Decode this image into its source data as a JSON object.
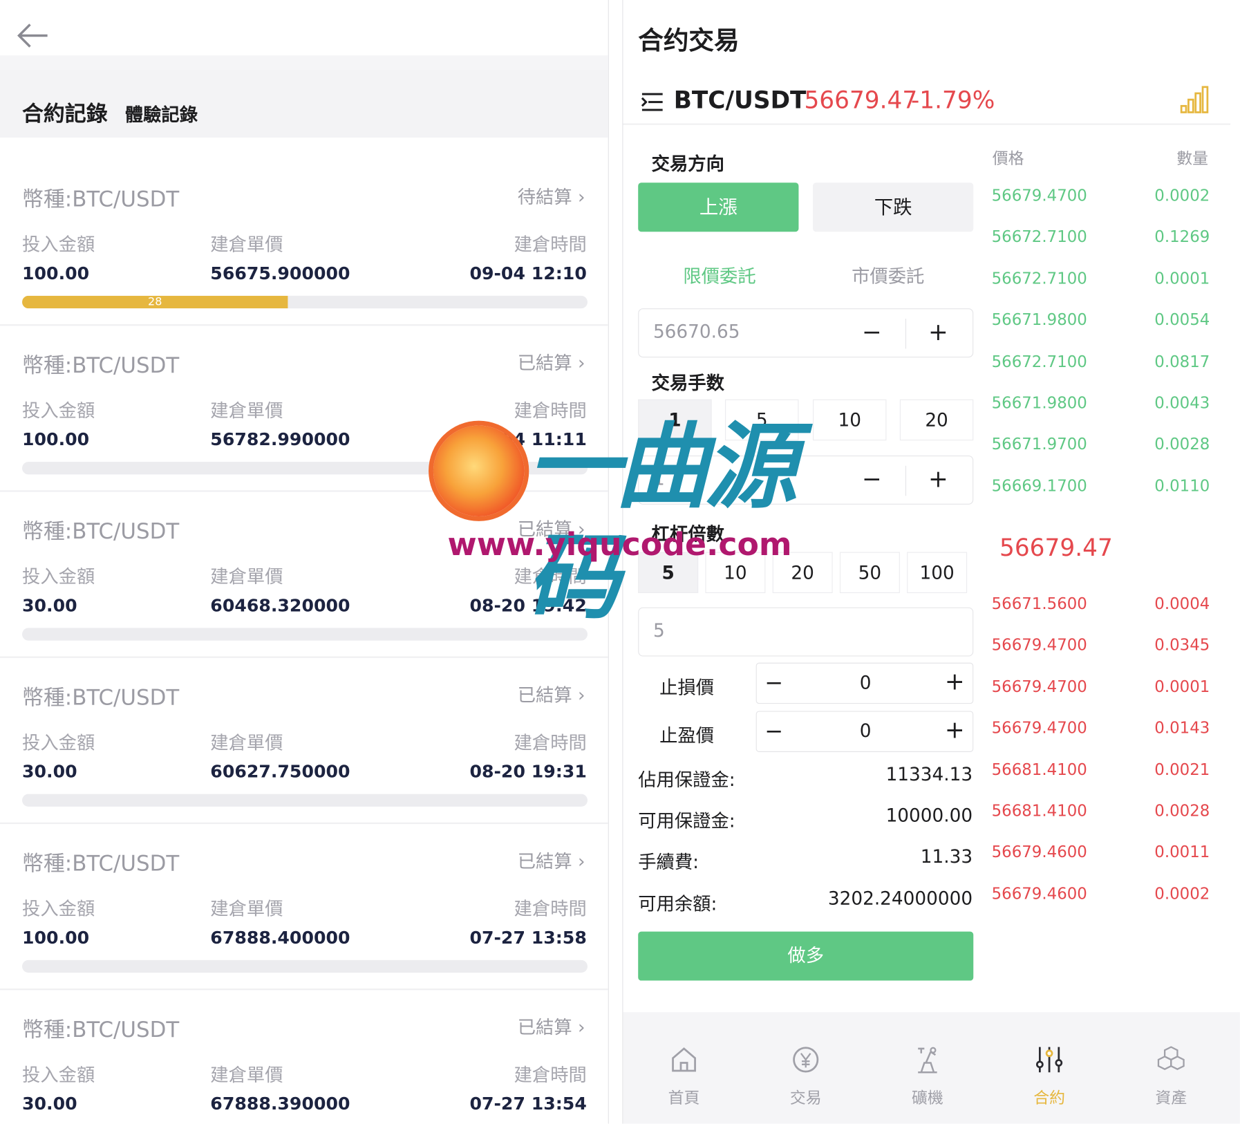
{
  "left": {
    "tabs": {
      "records": "合約記錄",
      "trial": "體驗記錄"
    },
    "records": [
      {
        "coin": "幣種:BTC/USDT",
        "status": "待結算",
        "h1": "投入金額",
        "h2": "建倉單價",
        "h3": "建倉時間",
        "amount": "100.00",
        "unit_price": "56675.900000",
        "time": "09-04 12:10",
        "progress": 0.47,
        "progress_label": "28"
      },
      {
        "coin": "幣種:BTC/USDT",
        "status": "已結算",
        "h1": "投入金額",
        "h2": "建倉單價",
        "h3": "建倉時間",
        "amount": "100.00",
        "unit_price": "56782.990000",
        "time": "09-04 11:11",
        "progress": 0,
        "progress_label": ""
      },
      {
        "coin": "幣種:BTC/USDT",
        "status": "已結算",
        "h1": "投入金額",
        "h2": "建倉單價",
        "h3": "建倉時間",
        "amount": "30.00",
        "unit_price": "60468.320000",
        "time": "08-20 19:42",
        "progress": 0,
        "progress_label": ""
      },
      {
        "coin": "幣種:BTC/USDT",
        "status": "已結算",
        "h1": "投入金額",
        "h2": "建倉單價",
        "h3": "建倉時間",
        "amount": "30.00",
        "unit_price": "60627.750000",
        "time": "08-20 19:31",
        "progress": 0,
        "progress_label": ""
      },
      {
        "coin": "幣種:BTC/USDT",
        "status": "已結算",
        "h1": "投入金額",
        "h2": "建倉單價",
        "h3": "建倉時間",
        "amount": "100.00",
        "unit_price": "67888.400000",
        "time": "07-27 13:58",
        "progress": 0,
        "progress_label": ""
      },
      {
        "coin": "幣種:BTC/USDT",
        "status": "已結算",
        "h1": "投入金額",
        "h2": "建倉單價",
        "h3": "建倉時間",
        "amount": "30.00",
        "unit_price": "67888.390000",
        "time": "07-27 13:54",
        "progress": 0,
        "progress_label": ""
      }
    ]
  },
  "right": {
    "title": "合约交易",
    "pair": "BTC/USDT",
    "price": "56679.47",
    "change": "-1.79%",
    "direction_label": "交易方向",
    "btn_up": "上漲",
    "btn_down": "下跌",
    "limit_order": "限價委託",
    "market_order": "市價委託",
    "price_input": "56670.65",
    "lots_label": "交易手数",
    "lots_options": [
      "1",
      "5",
      "10",
      "20"
    ],
    "lots_input": "1",
    "leverage_label": "杠杆倍數",
    "leverage_options": [
      "5",
      "10",
      "20",
      "50",
      "100"
    ],
    "leverage_input": "5",
    "stop_loss_label": "止損價",
    "stop_loss_value": "0",
    "take_profit_label": "止盈價",
    "take_profit_value": "0",
    "margin_used_label": "佔用保證金:",
    "margin_used": "11334.13",
    "margin_avail_label": "可用保證金:",
    "margin_avail": "10000.00",
    "fee_label": "手續費:",
    "fee": "11.33",
    "balance_label": "可用余額:",
    "balance": "3202.24000000",
    "submit": "做多",
    "book_price_header": "價格",
    "book_qty_header": "數量",
    "asks": [
      {
        "p": "56679.4700",
        "q": "0.0002"
      },
      {
        "p": "56672.7100",
        "q": "0.1269"
      },
      {
        "p": "56672.7100",
        "q": "0.0001"
      },
      {
        "p": "56671.9800",
        "q": "0.0054"
      },
      {
        "p": "56672.7100",
        "q": "0.0817"
      },
      {
        "p": "56671.9800",
        "q": "0.0043"
      },
      {
        "p": "56671.9700",
        "q": "0.0028"
      },
      {
        "p": "56669.1700",
        "q": "0.0110"
      }
    ],
    "mid_price": "56679.47",
    "bids": [
      {
        "p": "56671.5600",
        "q": "0.0004"
      },
      {
        "p": "56679.4700",
        "q": "0.0345"
      },
      {
        "p": "56679.4700",
        "q": "0.0001"
      },
      {
        "p": "56679.4700",
        "q": "0.0143"
      },
      {
        "p": "56681.4100",
        "q": "0.0021"
      },
      {
        "p": "56681.4100",
        "q": "0.0028"
      },
      {
        "p": "56679.4600",
        "q": "0.0011"
      },
      {
        "p": "56679.4600",
        "q": "0.0002"
      }
    ],
    "nav": [
      {
        "label": "首頁",
        "icon": "home-icon"
      },
      {
        "label": "交易",
        "icon": "yen-coin-icon"
      },
      {
        "label": "礦機",
        "icon": "mining-machine-icon"
      },
      {
        "label": "合約",
        "icon": "contract-sliders-icon",
        "active": true
      },
      {
        "label": "資產",
        "icon": "assets-cubes-icon"
      }
    ]
  },
  "watermark": {
    "brand": "一曲源码",
    "url": "www.yiqucode.com"
  },
  "colors": {
    "green": "#5fc884",
    "red": "#e5484d",
    "accent": "#e6b73f"
  }
}
